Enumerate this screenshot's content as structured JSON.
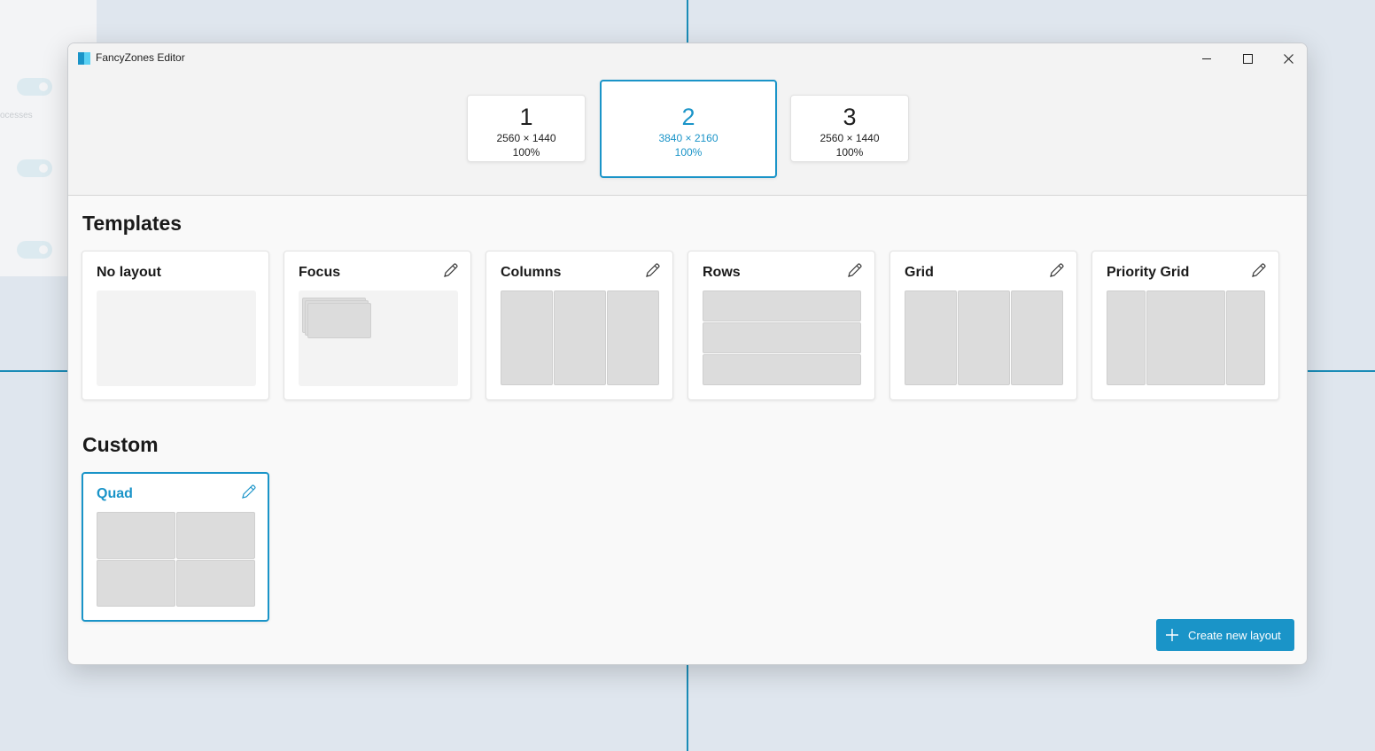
{
  "background": {
    "faded_label": "ocesses"
  },
  "window": {
    "title": "FancyZones Editor",
    "controls": {
      "minimize": "minimize",
      "maximize": "maximize",
      "close": "close"
    }
  },
  "monitors": [
    {
      "number": "1",
      "resolution": "2560 × 1440",
      "scale": "100%",
      "selected": false
    },
    {
      "number": "2",
      "resolution": "3840 × 2160",
      "scale": "100%",
      "selected": true
    },
    {
      "number": "3",
      "resolution": "2560 × 1440",
      "scale": "100%",
      "selected": false
    }
  ],
  "templates": {
    "title": "Templates",
    "items": [
      {
        "name": "No layout",
        "editable": false
      },
      {
        "name": "Focus",
        "editable": true
      },
      {
        "name": "Columns",
        "editable": true
      },
      {
        "name": "Rows",
        "editable": true
      },
      {
        "name": "Grid",
        "editable": true
      },
      {
        "name": "Priority Grid",
        "editable": true
      }
    ]
  },
  "custom": {
    "title": "Custom",
    "items": [
      {
        "name": "Quad",
        "editable": true,
        "selected": true
      }
    ]
  },
  "create_button": {
    "label": "Create new layout",
    "icon": "plus-icon"
  },
  "colors": {
    "accent": "#1a94c8",
    "zone_fill": "#dcdcdc"
  }
}
